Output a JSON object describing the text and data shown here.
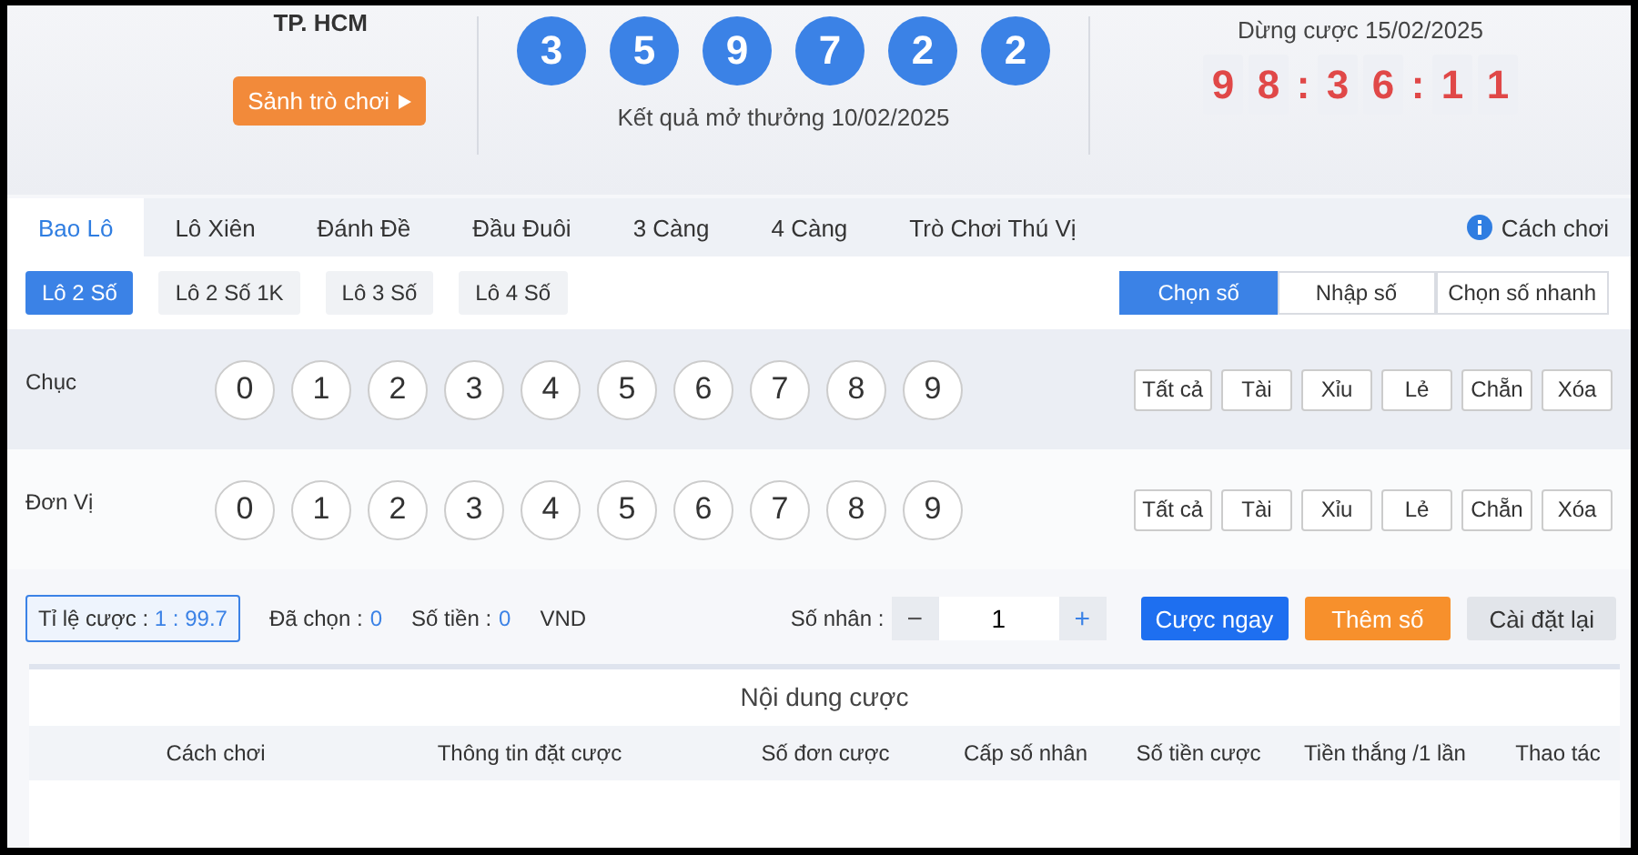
{
  "header": {
    "city": "TP. HCM",
    "lobby_button": "Sảnh trò chơi",
    "result_balls": [
      "3",
      "5",
      "9",
      "7",
      "2",
      "2"
    ],
    "result_caption": "Kết quả mở thưởng 10/02/2025",
    "stop_label": "Dừng cược 15/02/2025",
    "countdown": [
      "9",
      "8",
      ":",
      "3",
      "6",
      ":",
      "1",
      "1"
    ]
  },
  "tabs": [
    {
      "label": "Bao Lô",
      "selected": true
    },
    {
      "label": "Lô Xiên",
      "selected": false
    },
    {
      "label": "Đánh Đề",
      "selected": false
    },
    {
      "label": "Đầu Đuôi",
      "selected": false
    },
    {
      "label": "3 Càng",
      "selected": false
    },
    {
      "label": "4 Càng",
      "selected": false
    },
    {
      "label": "Trò Chơi Thú Vị",
      "selected": false
    }
  ],
  "help_link": "Cách chơi",
  "subtabs": [
    {
      "label": "Lô 2 Số",
      "selected": true
    },
    {
      "label": "Lô 2 Số 1K",
      "selected": false
    },
    {
      "label": "Lô 3 Số",
      "selected": false
    },
    {
      "label": "Lô 4 Số",
      "selected": false
    }
  ],
  "modes": [
    {
      "label": "Chọn số",
      "selected": true
    },
    {
      "label": "Nhập số",
      "selected": false
    },
    {
      "label": "Chọn số nhanh",
      "selected": false
    }
  ],
  "digit_rows": [
    {
      "label": "Chục",
      "digits": [
        "0",
        "1",
        "2",
        "3",
        "4",
        "5",
        "6",
        "7",
        "8",
        "9"
      ],
      "quick": [
        "Tất cả",
        "Tài",
        "Xỉu",
        "Lẻ",
        "Chẵn",
        "Xóa"
      ]
    },
    {
      "label": "Đơn Vị",
      "digits": [
        "0",
        "1",
        "2",
        "3",
        "4",
        "5",
        "6",
        "7",
        "8",
        "9"
      ],
      "quick": [
        "Tất cả",
        "Tài",
        "Xỉu",
        "Lẻ",
        "Chẵn",
        "Xóa"
      ]
    }
  ],
  "summary": {
    "odds_label": "Tỉ lệ cược :",
    "odds_value": "1 : 99.7",
    "selected_label": "Đã chọn :",
    "selected_value": "0",
    "amount_label": "Số tiền :",
    "amount_value": "0",
    "amount_unit": "VND",
    "multiplier_label": "Số nhân :",
    "minus": "−",
    "multiplier": "1",
    "plus": "+",
    "buttons": [
      {
        "label": "Cược ngay",
        "kind": "primary"
      },
      {
        "label": "Thêm số",
        "kind": "warning"
      },
      {
        "label": "Cài đặt lại",
        "kind": "plain"
      }
    ]
  },
  "bet_table": {
    "title": "Nội dung cược",
    "columns": [
      "Cách chơi",
      "Thông tin đặt cược",
      "Số đơn cược",
      "Cấp số nhân",
      "Số tiền cược",
      "Tiền thắng /1 lần",
      "Thao tác"
    ]
  }
}
